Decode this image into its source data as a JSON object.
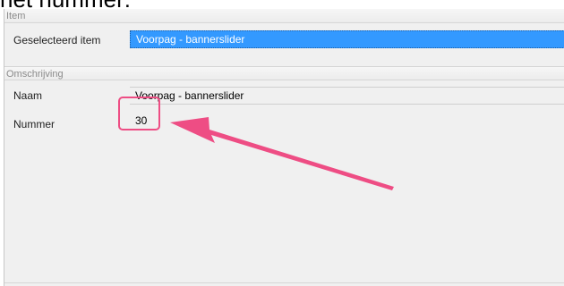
{
  "top_heading": "het nummer:",
  "sections": {
    "item": {
      "header": "Item",
      "selected_label": "Geselecteerd item",
      "selected_value": "Voorpag - bannerslider"
    },
    "omschrijving": {
      "header": "Omschrijving",
      "naam_label": "Naam",
      "naam_value": "Voorpag - bannerslider",
      "nummer_label": "Nummer",
      "nummer_value": "30"
    }
  },
  "annotation": {
    "highlight_color": "#ee4d84",
    "arrow_color": "#ee4d84"
  }
}
